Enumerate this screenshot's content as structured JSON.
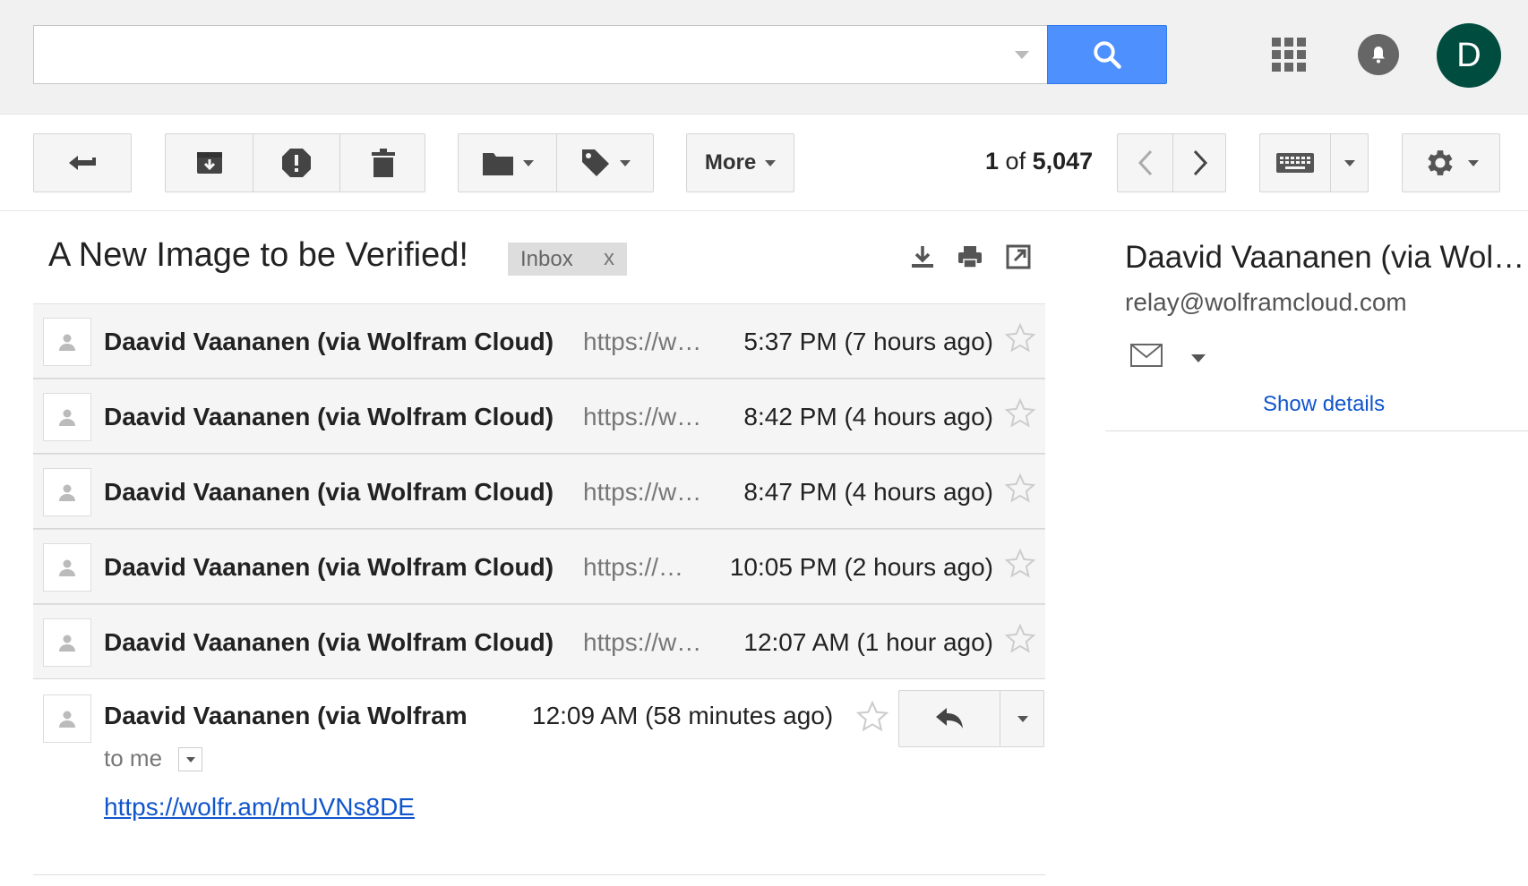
{
  "header": {
    "search_placeholder": "",
    "avatar_letter": "D",
    "accent_color": "#4d90fe"
  },
  "toolbar": {
    "more_label": "More",
    "counter": {
      "current": "1",
      "of_label": "of",
      "total": "5,047"
    }
  },
  "subject": {
    "title": "A New Image to be Verified!",
    "label": "Inbox",
    "label_remove": "x"
  },
  "thread": {
    "rows": [
      {
        "sender": "Daavid Vaananen (via Wolfram Cloud)",
        "snippet": "https://w…",
        "time": "5:37 PM (7 hours ago)"
      },
      {
        "sender": "Daavid Vaananen (via Wolfram Cloud)",
        "snippet": "https://w…",
        "time": "8:42 PM (4 hours ago)"
      },
      {
        "sender": "Daavid Vaananen (via Wolfram Cloud)",
        "snippet": "https://w…",
        "time": "8:47 PM (4 hours ago)"
      },
      {
        "sender": "Daavid Vaananen (via Wolfram Cloud)",
        "snippet": "https://…",
        "time": "10:05 PM (2 hours ago)"
      },
      {
        "sender": "Daavid Vaananen (via Wolfram Cloud)",
        "snippet": "https://w…",
        "time": "12:07 AM (1 hour ago)"
      }
    ],
    "expanded": {
      "sender": "Daavid Vaananen (via Wolfram",
      "time": "12:09 AM (58 minutes ago)",
      "to_line": "to me",
      "link": "https://wolfr.am/mUVNs8DE"
    }
  },
  "sidebar": {
    "name": "Daavid Vaananen (via Wol…",
    "email": "relay@wolframcloud.com",
    "show_details": "Show details"
  }
}
